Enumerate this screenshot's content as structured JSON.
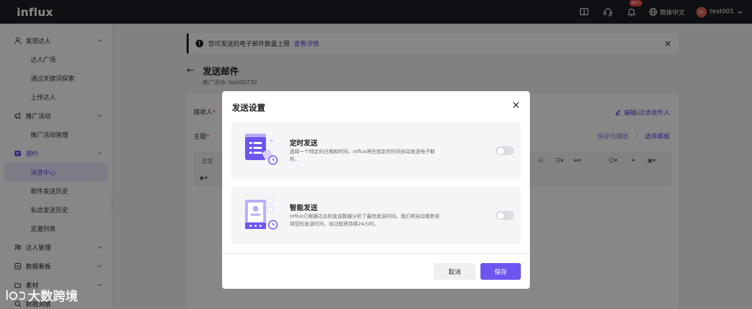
{
  "app": {
    "logo": "influx",
    "badge_count": "99+",
    "language": "简体中文",
    "username": "test001",
    "avatar_text": "te"
  },
  "sidebar": {
    "groups": [
      {
        "label": "发现达人",
        "items": [
          "达人广场",
          "通过关键词探索",
          "上传达人"
        ]
      },
      {
        "label": "推广活动",
        "items": [
          "推广活动管理"
        ]
      },
      {
        "label": "邀约",
        "items": [
          "消息中心",
          "邮件发送历史",
          "私信发送历史",
          "定邀列表"
        ]
      },
      {
        "label": "达人管理",
        "items": []
      },
      {
        "label": "数据看板",
        "items": []
      },
      {
        "label": "素材",
        "items": []
      },
      {
        "label": "数据洞察",
        "items": []
      }
    ],
    "active_item": "消息中心"
  },
  "notice": {
    "text": "您可发送的电子邮件数量上限",
    "link": "查看详情"
  },
  "page": {
    "title": "发送邮件",
    "subtitle": "推广活动: test00730",
    "recipient_label": "接收人",
    "edit_recipients": "编辑/过滤收件人",
    "subject_label": "主题",
    "save_template": "保存为模板",
    "choose_template": "选择模板",
    "toolbar_body": "正文"
  },
  "modal": {
    "title": "发送设置",
    "options": [
      {
        "title": "定时发送",
        "desc": "选择一个特定的日期和时间，Influx将在指定的时间自动发送电子邮件。",
        "enabled": false,
        "icon": "scheduled-send-illustration"
      },
      {
        "title": "智能发送",
        "desc": "Influx已根据过去的发送数据分析了最佳发送时间。我们将自动重新安排您的发送时间，该过程将持续24小时。",
        "enabled": false,
        "icon": "smart-send-illustration"
      }
    ],
    "cancel_label": "取消",
    "save_label": "保存"
  },
  "watermark": {
    "text": "大数跨境"
  },
  "colors": {
    "accent": "#6d55f0",
    "topbar": "#1e1f24"
  }
}
